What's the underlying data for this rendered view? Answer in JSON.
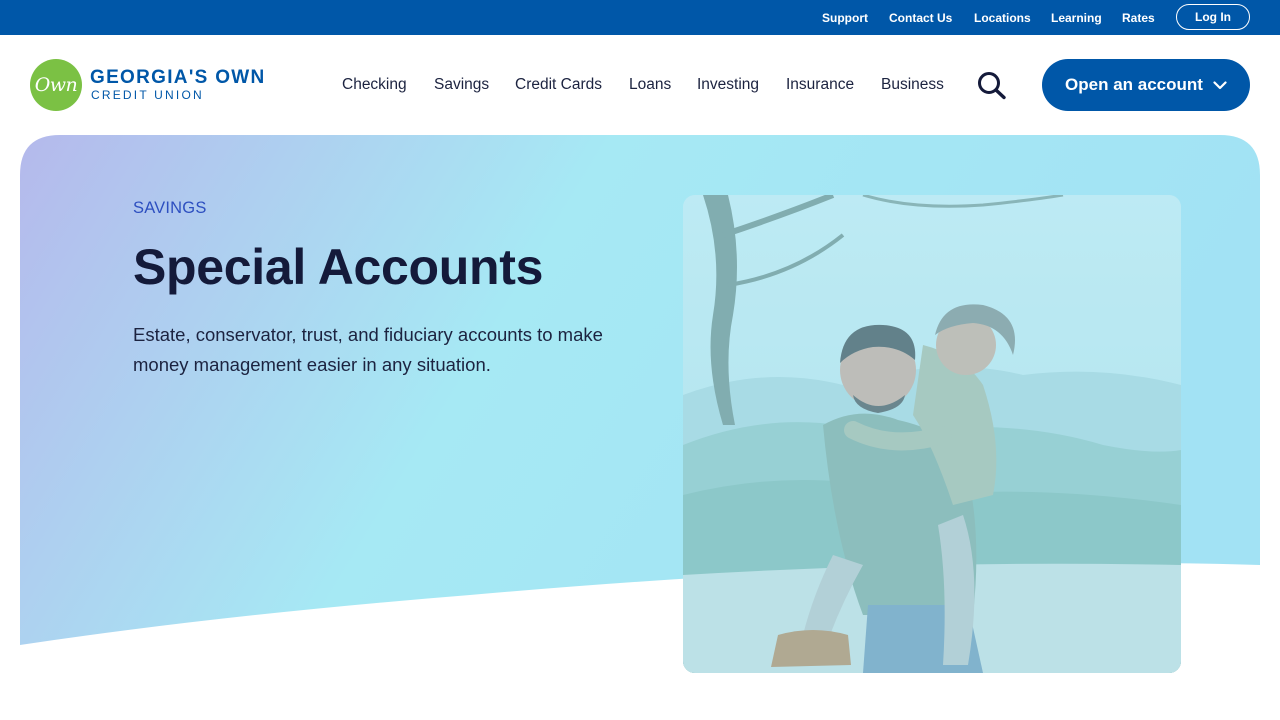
{
  "utility_nav": {
    "links": [
      "Support",
      "Contact Us",
      "Locations",
      "Learning",
      "Rates"
    ],
    "login_label": "Log In"
  },
  "brand": {
    "logo_mark": "Own",
    "name": "GEORGIA'S OWN",
    "subname": "CREDIT UNION",
    "primary_color": "#0057a8",
    "logo_color": "#7bc144"
  },
  "main_nav": {
    "items": [
      "Checking",
      "Savings",
      "Credit Cards",
      "Loans",
      "Investing",
      "Insurance",
      "Business"
    ],
    "search_icon": "search-icon",
    "cta_label": "Open an account",
    "cta_icon": "chevron-down-icon"
  },
  "hero": {
    "eyebrow": "SAVINGS",
    "title": "Special Accounts",
    "description": "Estate, conservator, trust, and fiduciary accounts to make money management easier in any situation.",
    "gradient_start": "#b5b9ec",
    "gradient_end": "#a6e9f4",
    "photo_alt": "Smiling man giving a young boy a piggyback ride outdoors"
  }
}
